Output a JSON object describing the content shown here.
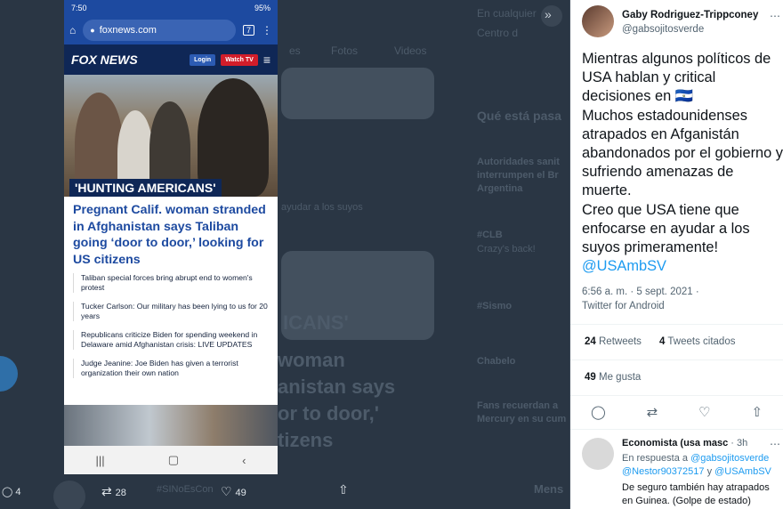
{
  "phone": {
    "status": {
      "time": "7:50",
      "battery": "95%"
    },
    "url": "foxnews.com",
    "tab_count": "7",
    "header": {
      "logo": "FOX NEWS",
      "login": "Login",
      "watch": "Watch TV"
    },
    "kicker": "'HUNTING AMERICANS'",
    "headline": "Pregnant Calif. woman stranded in Afghanistan says Taliban going ‘door to door,’ looking for US citizens",
    "links": [
      "Taliban special forces bring abrupt end to women's protest",
      "Tucker Carlson: Our military has been lying to us for 20 years",
      "Republicans criticize Biden for spending weekend in Delaware amid Afghanistan crisis: LIVE UPDATES",
      "Judge Jeanine: Joe Biden has given a terrorist organization their own nation"
    ]
  },
  "background": {
    "search": "En cualquier",
    "center": "Centro d",
    "trends_title": "Qué está pasa",
    "trend1": "Autoridades sanit",
    "trend2": "interrumpen el Br",
    "trend3": "Argentina",
    "hashtag1": "#CLB",
    "hashtag1_sub": "Crazy's back!",
    "hashtag2": "#Sismo",
    "trend4": "Chabelo",
    "trend5": "Fans recuerdan a",
    "trend6": "Mercury en su cum",
    "tweet_text": "y sufriendo amenazas de muerte.",
    "tweet_text2": "ayudar a los suyos",
    "big_word1": "woman",
    "big_word2": "anistan says",
    "big_word3": "or to door,'",
    "big_word4": "tizens",
    "big_word5": "ICANS'",
    "tabs": [
      "es",
      "Fotos",
      "Videos"
    ],
    "left_counts": {
      "reply": "4",
      "retweet": "28",
      "like": "49"
    },
    "bottom_text": "#SINoEsCon",
    "bottom_text2": "Mens"
  },
  "panel": {
    "name": "Gaby Rodriguez-Trippconey",
    "handle": "@gabsojitosverde",
    "tweet_lines": [
      "Mientras algunos políticos de USA hablan y critical decisiones en 🇸🇻",
      "Muchos estadounidenses atrapados en Afganistán abandonados por el gobierno y sufriendo amenazas de muerte.",
      "Creo que USA tiene que enfocarse en ayudar a los suyos primeramente!"
    ],
    "mention": "@USAmbSV",
    "timestamp": "6:56 a. m. · 5 sept. 2021 ·",
    "client": "Twitter for Android",
    "retweets_count": "24",
    "retweets_label": "Retweets",
    "quotes_count": "4",
    "quotes_label": "Tweets citados",
    "likes_count": "49",
    "likes_label": "Me gusta",
    "reply": {
      "name": "Economista (usa masc",
      "time": "· 3h",
      "in_reply": "En respuesta a",
      "to1": "@gabsojitosverde",
      "to2": "@Nestor90372517",
      "and": "y",
      "to3": "@USAmbSV",
      "text_line1": "De seguro también hay atrapados",
      "text_line2": "en Guinea. (Golpe de estado)"
    }
  }
}
